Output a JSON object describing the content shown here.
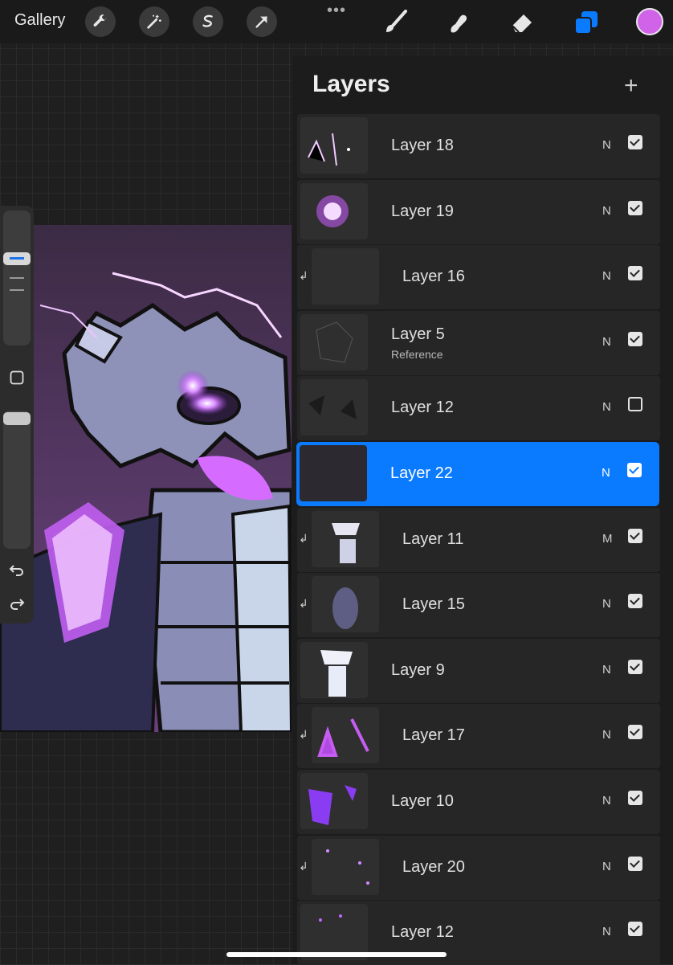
{
  "topbar": {
    "gallery_label": "Gallery",
    "more_dots": "•••",
    "left_tools": [
      "wrench-icon",
      "magic-wand-icon",
      "selection-icon",
      "transform-arrow-icon"
    ],
    "right_tools": [
      "brush-icon",
      "smudge-icon",
      "eraser-icon",
      "layers-icon"
    ],
    "current_color": "#d163e8",
    "active_tool_color": "#0a7aff"
  },
  "layers_panel": {
    "title": "Layers",
    "add_label": "+",
    "rows": [
      {
        "name": "Layer 18",
        "blend": "N",
        "visible": true,
        "clipped": false,
        "selected": false
      },
      {
        "name": "Layer 19",
        "blend": "N",
        "visible": true,
        "clipped": false,
        "selected": false
      },
      {
        "name": "Layer 16",
        "blend": "N",
        "visible": true,
        "clipped": true,
        "selected": false
      },
      {
        "name": "Layer 5",
        "sub": "Reference",
        "blend": "N",
        "visible": true,
        "clipped": false,
        "selected": false
      },
      {
        "name": "Layer 12",
        "blend": "N",
        "visible": false,
        "clipped": false,
        "selected": false
      },
      {
        "name": "Layer 22",
        "blend": "N",
        "visible": true,
        "clipped": false,
        "selected": true
      },
      {
        "name": "Layer 11",
        "blend": "M",
        "visible": true,
        "clipped": true,
        "selected": false
      },
      {
        "name": "Layer 15",
        "blend": "N",
        "visible": true,
        "clipped": true,
        "selected": false
      },
      {
        "name": "Layer 9",
        "blend": "N",
        "visible": true,
        "clipped": false,
        "selected": false
      },
      {
        "name": "Layer 17",
        "blend": "N",
        "visible": true,
        "clipped": true,
        "selected": false
      },
      {
        "name": "Layer 10",
        "blend": "N",
        "visible": true,
        "clipped": false,
        "selected": false
      },
      {
        "name": "Layer 20",
        "blend": "N",
        "visible": true,
        "clipped": true,
        "selected": false
      },
      {
        "name": "Layer 12",
        "blend": "N",
        "visible": true,
        "clipped": false,
        "selected": false
      }
    ]
  },
  "sidebar": {
    "undo_icon": "undo-icon",
    "redo_icon": "redo-icon",
    "modify_icon": "square-icon"
  }
}
